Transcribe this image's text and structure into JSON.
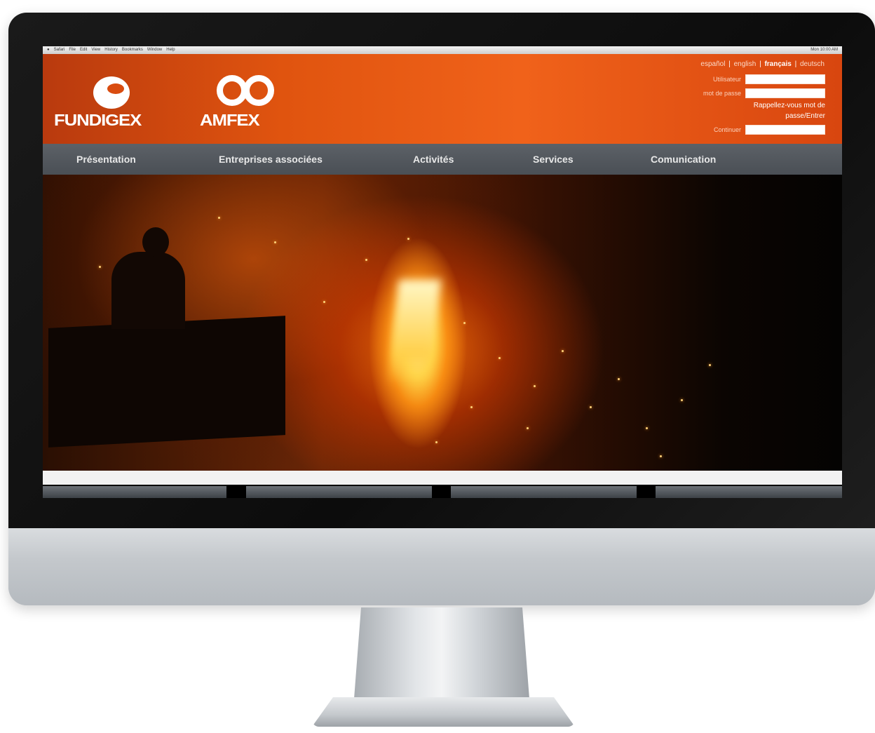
{
  "os_menubar": {
    "left_items": [
      "Safari",
      "File",
      "Edit",
      "View",
      "History",
      "Bookmarks",
      "Window",
      "Help"
    ],
    "right_text": "Mon 10:00 AM"
  },
  "brand": {
    "primary_logo": "FUNDIGEX",
    "secondary_logo": "AMFEX"
  },
  "language_bar": {
    "items": [
      {
        "label": "español",
        "active": false
      },
      {
        "label": "english",
        "active": false
      },
      {
        "label": "français",
        "active": true
      },
      {
        "label": "deutsch",
        "active": false
      }
    ]
  },
  "login": {
    "user_label": "Utilisateur",
    "password_label": "mot de passe",
    "remember_line1": "Rappellez-vous mot de",
    "remember_line2": "passe/Entrer",
    "enter_label": "Continuer"
  },
  "nav": {
    "items": [
      "Présentation",
      "Entreprises associées",
      "Activités",
      "Services",
      "Comunication"
    ]
  },
  "bottom_tiles": [
    "",
    "",
    "",
    ""
  ],
  "colors": {
    "header_orange": "#e0540f",
    "nav_gray": "#4f545a",
    "hero_fire": "#ff8a1a"
  }
}
